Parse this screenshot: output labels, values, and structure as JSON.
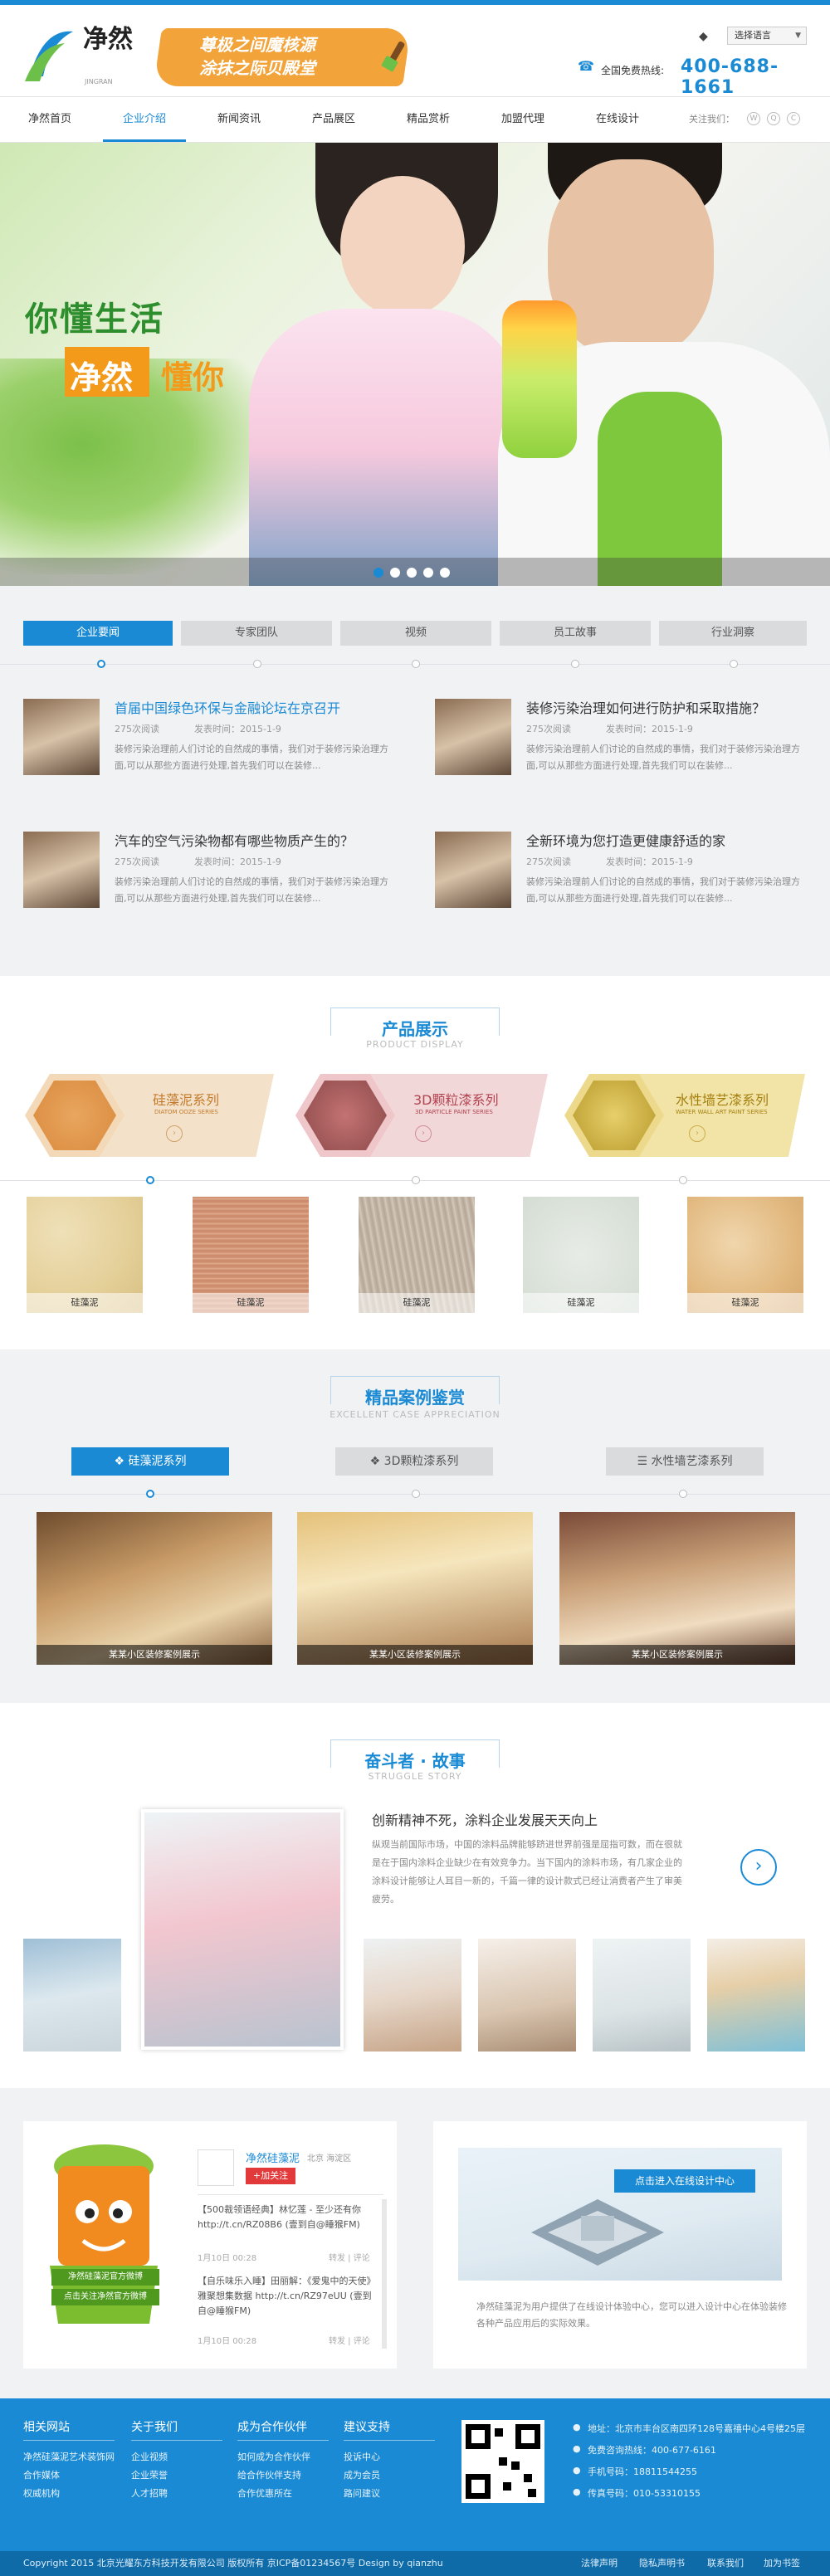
{
  "header": {
    "logo_text": "净然",
    "logo_sub": "JINGRAN",
    "slogan_line1": "尊极之间魔核源",
    "slogan_line2": "涂抹之际贝殿堂",
    "lang_select": "选择语言",
    "hotline_label": "全国免费热线:",
    "hotline_number": "400-688-1661"
  },
  "nav": {
    "items": [
      "净然首页",
      "企业介绍",
      "新闻资讯",
      "产品展区",
      "精品赏析",
      "加盟代理",
      "在线设计"
    ],
    "active_index": 1,
    "follow_label": "关注我们："
  },
  "banner": {
    "title1": "你懂生活",
    "title2a": "净然",
    "title2b": "懂你",
    "slides": 5,
    "active_slide": 1
  },
  "news": {
    "tabs": [
      "企业要闻",
      "专家团队",
      "视频",
      "员工故事",
      "行业洞察"
    ],
    "active_tab": 0,
    "items": [
      {
        "title": "首届中国绿色环保与金融论坛在京召开",
        "views": "275次阅读",
        "date": "发表时间：2015-1-9",
        "desc": "装修污染治理前人们讨论的自然成的事情，我们对于装修污染治理方面,可以从那些方面进行处理,首先我们可以在装修..."
      },
      {
        "title": "装修污染治理如何进行防护和采取措施？",
        "views": "275次阅读",
        "date": "发表时间：2015-1-9",
        "desc": "装修污染治理前人们讨论的自然成的事情，我们对于装修污染治理方面,可以从那些方面进行处理,首先我们可以在装修..."
      },
      {
        "title": "汽车的空气污染物都有哪些物质产生的？",
        "views": "275次阅读",
        "date": "发表时间：2015-1-9",
        "desc": "装修污染治理前人们讨论的自然成的事情，我们对于装修污染治理方面,可以从那些方面进行处理,首先我们可以在装修..."
      },
      {
        "title": "全新环境为您打造更健康舒适的家",
        "views": "275次阅读",
        "date": "发表时间：2015-1-9",
        "desc": "装修污染治理前人们讨论的自然成的事情，我们对于装修污染治理方面,可以从那些方面进行处理,首先我们可以在装修..."
      }
    ]
  },
  "products": {
    "title": "产品展示",
    "subtitle": "PRODUCT DISPLAY",
    "series": [
      {
        "name": "硅藻泥系列",
        "sub": "DIATOM OOZE SERIES",
        "color": "#f3e2c9",
        "text": "#c47a2c"
      },
      {
        "name": "3D颗粒漆系列",
        "sub": "3D PARTICLE PAINT SERIES",
        "color": "#f2d7d9",
        "text": "#b2434f"
      },
      {
        "name": "水性墙艺漆系列",
        "sub": "WATER WALL ART PAINT SERIES",
        "color": "#f2e4a6",
        "text": "#a47f10"
      }
    ],
    "textures": [
      "硅藻泥",
      "硅藻泥",
      "硅藻泥",
      "硅藻泥",
      "硅藻泥"
    ]
  },
  "cases": {
    "title": "精品案例鉴赏",
    "subtitle": "EXCELLENT CASE APPRECIATION",
    "tabs": [
      "硅藻泥系列",
      "3D颗粒漆系列",
      "水性墙艺漆系列"
    ],
    "active_tab": 0,
    "items": [
      "某某小区装修案例展示",
      "某某小区装修案例展示",
      "某某小区装修案例展示"
    ]
  },
  "story": {
    "title": "奋斗者 · 故事",
    "subtitle": "STRUGGLE STORY",
    "headline": "创新精神不死，涂料企业发展天天向上",
    "body": "纵观当前国际市场，中国的涂料品牌能够跻进世界前强是屈指可数，而在很就是在于国内涂料企业缺少在有效竞争力。当下国内的涂料市场，有几家企业的涂料设计能够让人耳目一新的，千篇一律的设计款式已经让消费者产生了审美疲劳。"
  },
  "weibo": {
    "account": "净然硅藻泥",
    "location": "北京 海淀区",
    "follow": "+加关注",
    "mascot_line1": "净然硅藻泥官方微博",
    "mascot_line2": "点击关注净然官方微博",
    "posts": [
      {
        "text": "【500裁领语经典】林忆莲 - 至少还有你 http://t.cn/RZ08B6 (壹到自@睡猴FM)",
        "date": "1月10日 00:28",
        "actions": "转发 | 评论"
      },
      {
        "text": "【自乐味乐入睡】田丽解：《爱鬼中的天使》雅聚想集数据 http://t.cn/RZ97eUU (壹到自@睡猴FM)",
        "date": "1月10日 00:28",
        "actions": "转发 | 评论"
      }
    ]
  },
  "design": {
    "button": "点击进入在线设计中心",
    "desc": "净然硅藻泥为用户提供了在线设计体验中心，您可以进入设计中心在体验装修各种产品应用后的实际效果。"
  },
  "footer": {
    "cols": [
      {
        "title": "相关网站",
        "items": [
          "净然硅藻泥艺术装饰网",
          "合作媒体",
          "权威机构"
        ]
      },
      {
        "title": "关于我们",
        "items": [
          "企业视频",
          "企业荣誉",
          "人才招聘"
        ]
      },
      {
        "title": "成为合作伙伴",
        "items": [
          "如何成为合作伙伴",
          "给合作伙伴支持",
          "合作优惠所在"
        ]
      },
      {
        "title": "建议支持",
        "items": [
          "投诉中心",
          "成为会员",
          "路问建议"
        ]
      }
    ],
    "contact": [
      {
        "icon": "location-icon",
        "text": "地址：北京市丰台区南四环128号嘉禧中心4号楼25层"
      },
      {
        "icon": "phone-icon",
        "text": "免费咨询热线：400-677-6161"
      },
      {
        "icon": "mobile-icon",
        "text": "手机号码：18811544255"
      },
      {
        "icon": "fax-icon",
        "text": "传真号码：010-53310155"
      }
    ],
    "copyright": "Copyright 2015 北京光耀东方科技开发有限公司 版权所有  京ICP备01234567号  Design by qianzhu",
    "links": [
      "法律声明",
      "隐私声明书",
      "联系我们",
      "加为书签"
    ]
  },
  "colors": {
    "brand_blue": "#1a8ad4",
    "accent_orange": "#f39a1b",
    "banner_green": "#2e8e2e"
  }
}
